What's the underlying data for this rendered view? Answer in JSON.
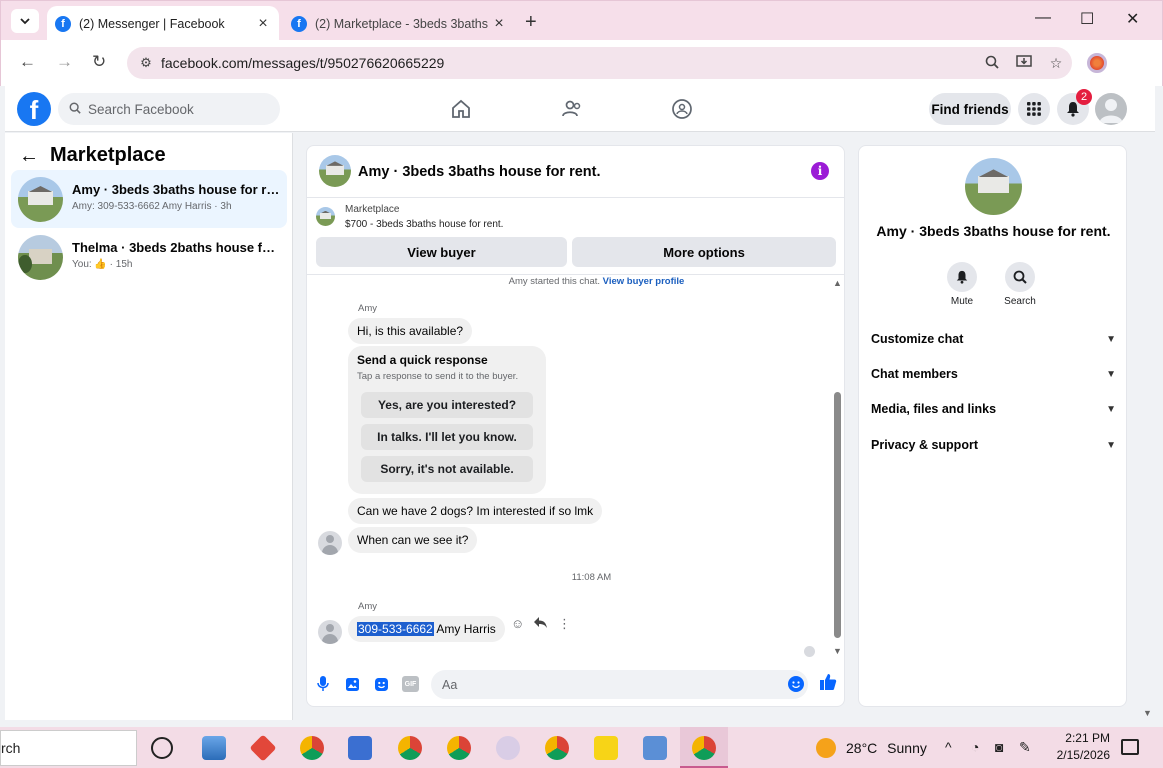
{
  "browser": {
    "tabs": [
      {
        "title": "(2) Messenger | Facebook",
        "active": true
      },
      {
        "title": "(2) Marketplace - 3beds 3baths",
        "active": false
      }
    ],
    "url": "facebook.com/messages/t/950276620665229",
    "new_tab": "+",
    "minimize": "—",
    "maximize": "☐",
    "close": "✕"
  },
  "fb_header": {
    "logo": "f",
    "search_placeholder": "Search Facebook",
    "find_friends": "Find friends",
    "notifications_count": "2"
  },
  "left_panel": {
    "title": "Marketplace",
    "conversations": [
      {
        "name": "Amy · 3beds 3baths house for rent.",
        "preview": "Amy: 309-533-6662 Amy Harris · 3h"
      },
      {
        "name": "Thelma · 3beds 2baths house for r...",
        "preview": "You: 👍 · 15h"
      }
    ]
  },
  "chat": {
    "title": "Amy · 3beds 3baths house for rent.",
    "info_icon": "i",
    "marketplace_label": "Marketplace",
    "listing": "$700 - 3beds 3baths house for rent.",
    "view_buyer": "View buyer",
    "more_options": "More options",
    "system_line": "Amy started this chat.",
    "system_link": "View buyer profile",
    "sender_1": "Amy",
    "msg_1": "Hi, is this available?",
    "quick_title": "Send a quick response",
    "quick_sub": "Tap a response to send it to the buyer.",
    "quick_replies": [
      "Yes, are you interested?",
      "In talks. I'll let you know.",
      "Sorry, it's not available."
    ],
    "msg_2": "Can we have 2 dogs? Im interested  if so lmk",
    "msg_3": "When can we see it?",
    "timestamp": "11:08 AM",
    "sender_2": "Amy",
    "msg_4_highlight": "309-533-6662",
    "msg_4_rest": " Amy Harris",
    "composer_placeholder": "Aa",
    "gif_label": "GIF"
  },
  "info_panel": {
    "name": "Amy · 3beds 3baths house for rent.",
    "actions": [
      "Mute",
      "Search"
    ],
    "sections": [
      "Customize chat",
      "Chat members",
      "Media, files and links",
      "Privacy & support"
    ]
  },
  "taskbar": {
    "search_text": "rch",
    "temperature": "28°C",
    "weather": "Sunny",
    "time": "2:21 PM",
    "date": "2/15/2026"
  },
  "colors": {
    "facebook_blue": "#1877f2",
    "messenger_blue": "#0866ff",
    "highlight": "#1d5fcf",
    "chrome_pink": "#f6dfea",
    "badge_red": "#e41e3f"
  }
}
